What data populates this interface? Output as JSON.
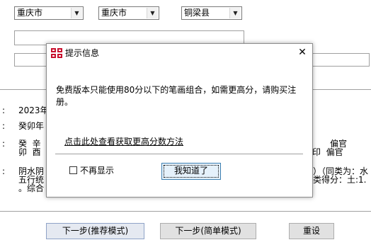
{
  "location": {
    "province": "重庆市",
    "city": "重庆市",
    "county": "铜梁县"
  },
  "background_text": {
    "colon_1": ":",
    "colon_2": ":",
    "colon_3": ":",
    "colon_4": ":",
    "row1": "2023年",
    "row2": "癸卯年",
    "row3a": "癸  辛",
    "row3b": "卯  酉",
    "right1": "偏官",
    "right2": "印  偏官",
    "row4a": "阴水阴",
    "row4b": "五行统",
    "row4c": "。综合",
    "right3": "）（同类为：水",
    "right4": "类得分：土:1."
  },
  "dialog": {
    "title": "提示信息",
    "message": "免费版本只能使用80分以下的笔画组合，如需更高分，请购买注册。",
    "link": "点击此处查看获取更高分数方法",
    "checkbox_label": "不再显示",
    "ok_button": "我知道了"
  },
  "buttons": {
    "next_recommended": "下一步(推荐模式)",
    "next_simple": "下一步(简单模式)",
    "reset": "重设"
  }
}
